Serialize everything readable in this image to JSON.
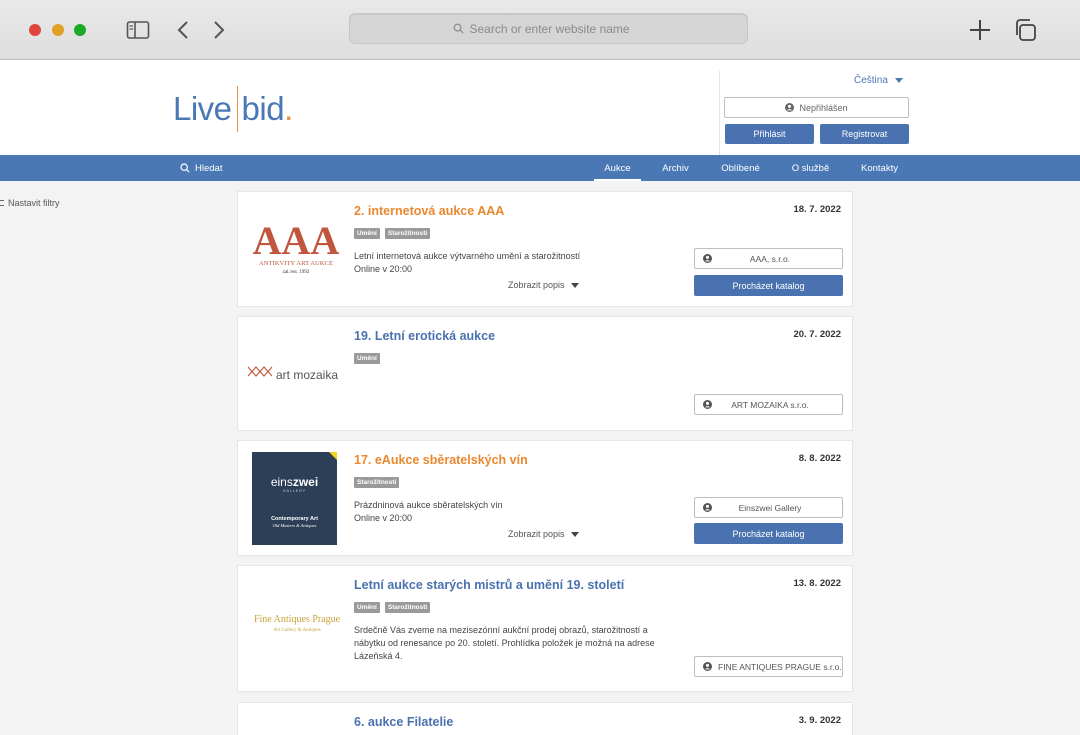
{
  "browser": {
    "address_placeholder": "Search or enter website name"
  },
  "header": {
    "logo_left": "Live",
    "logo_right": "bid",
    "logo_dot": ".",
    "language": "Čeština",
    "user_status": "Nepřihlášen",
    "login_label": "Přihlásit",
    "register_label": "Registrovat"
  },
  "nav": {
    "search_label": "Hledat",
    "items": [
      {
        "label": "Aukce",
        "active": true
      },
      {
        "label": "Archiv"
      },
      {
        "label": "Oblíbené"
      },
      {
        "label": "O službě"
      },
      {
        "label": "Kontakty"
      }
    ]
  },
  "filters": {
    "label": "Nastavit filtry"
  },
  "auctions": [
    {
      "title": "2. internetová aukce AAA",
      "date": "18. 7. 2022",
      "tags": [
        "Umění",
        "Starožitnosti"
      ],
      "description": [
        "Letní internetová aukce výtvarného umění a starožitností",
        "Online v 20:00"
      ],
      "show_description": "Zobrazit popis",
      "organizer": "AAA, s.r.o.",
      "catalog_label": "Procházet katalog",
      "logo": {
        "main": "AAA",
        "sub": "ANTIKVITY ART AUKCE",
        "est": "zal./est. 1992"
      }
    },
    {
      "title": "19. Letní erotická aukce",
      "date": "20. 7. 2022",
      "tags": [
        "Umění"
      ],
      "organizer": "ART MOZAIKA s.r.o.",
      "logo": {
        "text": "art mozaika"
      }
    },
    {
      "title": "17. eAukce sběratelských vín",
      "date": "8. 8. 2022",
      "tags": [
        "Starožitnosti"
      ],
      "description": [
        "Prázdninová aukce sběratelských vín",
        "Online v 20:00"
      ],
      "show_description": "Zobrazit popis",
      "organizer": "Einszwei Gallery",
      "catalog_label": "Procházet katalog",
      "logo": {
        "brand_a": "eins",
        "brand_b": "zwei",
        "gallery": "GALLERY",
        "line1": "Contemporary Art",
        "line2": "Old Masters & Antiques"
      }
    },
    {
      "title": "Letní aukce starých mistrů a umění 19. století",
      "date": "13. 8. 2022",
      "tags": [
        "Umění",
        "Starožitnosti"
      ],
      "description": [
        "Srdečně Vás zveme na mezisezónní aukční prodej obrazů, starožitností a",
        "nábytku od renesance po 20. století. Prohlídka položek je možná na adrese",
        "Lázeňská 4."
      ],
      "organizer": "FINE ANTIQUES PRAGUE s.r.o.",
      "logo": {
        "line1": "Fine Antiques Prague",
        "line2": "Art Gallery & Antiques"
      }
    },
    {
      "title": "6. aukce Filatelie",
      "date": "3. 9. 2022"
    }
  ],
  "colors": {
    "brand_blue": "#4a78b5",
    "accent_orange": "#e8882f"
  }
}
